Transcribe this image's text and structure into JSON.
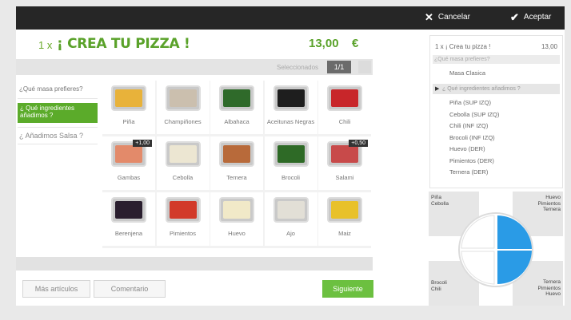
{
  "topbar": {
    "cancel": {
      "icon": "close-icon",
      "label": "Cancelar"
    },
    "accept": {
      "icon": "check-icon",
      "label": "Aceptar"
    }
  },
  "header": {
    "quantity": "1 x",
    "title": "¡ CREA TU PIZZA !",
    "price": "13,00",
    "currency": "€"
  },
  "selection": {
    "label": "Seleccionados",
    "count": "1/1"
  },
  "categories": [
    {
      "label": "¿Qué masa prefieres?",
      "active": false
    },
    {
      "label": "¿ Qué ingredientes añadimos ?",
      "active": true
    },
    {
      "label": "¿ Añadimos Salsa ?",
      "active": false
    }
  ],
  "ingredients": [
    {
      "name": "Piña",
      "color": "#e8b23a",
      "badge": ""
    },
    {
      "name": "Champiñones",
      "color": "#cbbfae",
      "badge": ""
    },
    {
      "name": "Albahaca",
      "color": "#2f6a2a",
      "badge": ""
    },
    {
      "name": "Aceitunas Negras",
      "color": "#1e1e1e",
      "badge": ""
    },
    {
      "name": "Chili",
      "color": "#c8262a",
      "badge": ""
    },
    {
      "name": "Gambas",
      "color": "#e38a6a",
      "badge": "+1,00"
    },
    {
      "name": "Cebolla",
      "color": "#ece6d2",
      "badge": ""
    },
    {
      "name": "Ternera",
      "color": "#b86a3a",
      "badge": ""
    },
    {
      "name": "Brocoli",
      "color": "#2e6a26",
      "badge": ""
    },
    {
      "name": "Salami",
      "color": "#c84a4a",
      "badge": "+0,50"
    },
    {
      "name": "Berenjena",
      "color": "#2a1e2e",
      "badge": ""
    },
    {
      "name": "Pimientos",
      "color": "#d23a2a",
      "badge": ""
    },
    {
      "name": "Huevo",
      "color": "#f1e9c8",
      "badge": ""
    },
    {
      "name": "Ajo",
      "color": "#e2dfd6",
      "badge": ""
    },
    {
      "name": "Maiz",
      "color": "#e8c12a",
      "badge": ""
    }
  ],
  "buttons": {
    "more": "Más artículos",
    "comment": "Comentario",
    "next": "Siguiente"
  },
  "summary": {
    "head": "1 x ¡ Crea tu pizza !",
    "price": "13,00",
    "question1": "¿Qué masa prefieres?",
    "masa": "Masa Clasica",
    "question2": "¿ Qué ingredientes añadimos ?",
    "items": [
      "Piña (SUP IZQ)",
      "Cebolla (SUP IZQ)",
      "Chili (INF IZQ)",
      "Brocoli (INF IZQ)",
      "Huevo (DER)",
      "Pimientos (DER)",
      "Ternera (DER)"
    ]
  },
  "pizza": {
    "top_left": [
      "Piña",
      "Cebolla"
    ],
    "top_right": [
      "Huevo",
      "Pimientos",
      "Ternera"
    ],
    "bottom_left": [
      "Brocoli",
      "Chili"
    ],
    "bottom_right": [
      "Ternera",
      "Pimientos",
      "Huevo"
    ],
    "selected_color": "#2a9be6"
  },
  "colors": {
    "accent": "#5bab2a",
    "next_button": "#6cc040",
    "topbar": "#262626"
  }
}
